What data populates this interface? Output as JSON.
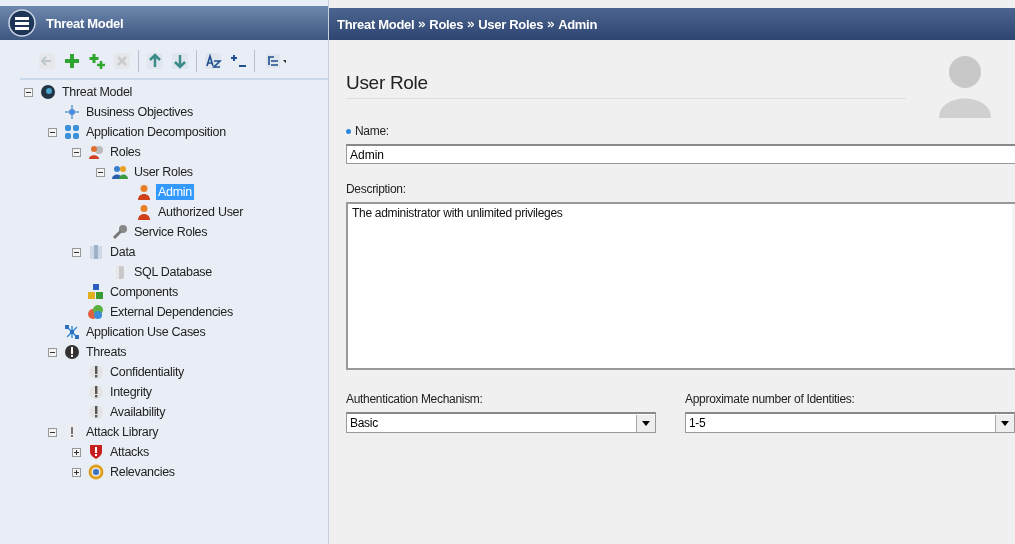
{
  "left_panel": {
    "title": "Threat Model"
  },
  "toolbar": [
    {
      "kind": "back",
      "disabled": true
    },
    {
      "kind": "add",
      "disabled": false
    },
    {
      "kind": "add-child",
      "disabled": false
    },
    {
      "kind": "delete",
      "disabled": true
    },
    {
      "kind": "separator"
    },
    {
      "kind": "up",
      "disabled": false
    },
    {
      "kind": "down",
      "disabled": false
    },
    {
      "kind": "separator"
    },
    {
      "kind": "sort",
      "disabled": false
    },
    {
      "kind": "collapse",
      "disabled": false
    },
    {
      "kind": "separator"
    },
    {
      "kind": "tree-menu",
      "disabled": false
    }
  ],
  "tree": [
    {
      "label": "Threat Model",
      "kind": "globe",
      "selected": false,
      "expanded": true,
      "children": [
        {
          "label": "Business Objectives",
          "kind": "target",
          "selected": false
        },
        {
          "label": "Application Decomposition",
          "kind": "grid",
          "selected": false,
          "expanded": true,
          "children": [
            {
              "label": "Roles",
              "kind": "person-key",
              "selected": false,
              "expanded": true,
              "children": [
                {
                  "label": "User Roles",
                  "kind": "people",
                  "selected": false,
                  "expanded": true,
                  "children": [
                    {
                      "label": "Admin",
                      "kind": "person",
                      "selected": true
                    },
                    {
                      "label": "Authorized User",
                      "kind": "person",
                      "selected": false
                    }
                  ]
                },
                {
                  "label": "Service Roles",
                  "kind": "key",
                  "selected": false
                }
              ]
            },
            {
              "label": "Data",
              "kind": "database",
              "selected": false,
              "expanded": true,
              "children": [
                {
                  "label": "SQL Database",
                  "kind": "cylinder",
                  "selected": false
                }
              ]
            },
            {
              "label": "Components",
              "kind": "cubes",
              "selected": false
            },
            {
              "label": "External Dependencies",
              "kind": "spheres",
              "selected": false
            }
          ]
        },
        {
          "label": "Application Use Cases",
          "kind": "network",
          "selected": false
        },
        {
          "label": "Threats",
          "kind": "alert-dark",
          "selected": false,
          "expanded": true,
          "children": [
            {
              "label": "Confidentiality",
              "kind": "alert",
              "selected": false
            },
            {
              "label": "Integrity",
              "kind": "alert",
              "selected": false
            },
            {
              "label": "Availability",
              "kind": "alert",
              "selected": false
            }
          ]
        },
        {
          "label": "Attack Library",
          "kind": "alert-light",
          "selected": false,
          "expanded": true,
          "children": [
            {
              "label": "Attacks",
              "kind": "shield",
              "selected": false,
              "expanded": false
            },
            {
              "label": "Relevancies",
              "kind": "ring",
              "selected": false,
              "expanded": false
            }
          ]
        }
      ]
    }
  ],
  "breadcrumb": [
    "Threat Model",
    "Roles",
    "User Roles",
    "Admin"
  ],
  "form": {
    "heading": "User Role",
    "name": {
      "label": "Name:",
      "required": true,
      "value": "Admin"
    },
    "description": {
      "label": "Description:",
      "value": "The administrator with unlimited privileges"
    },
    "authentication": {
      "label": "Authentication Mechanism:",
      "value": "Basic"
    },
    "identities": {
      "label": "Approximate number of Identities:",
      "value": "1-5"
    }
  }
}
